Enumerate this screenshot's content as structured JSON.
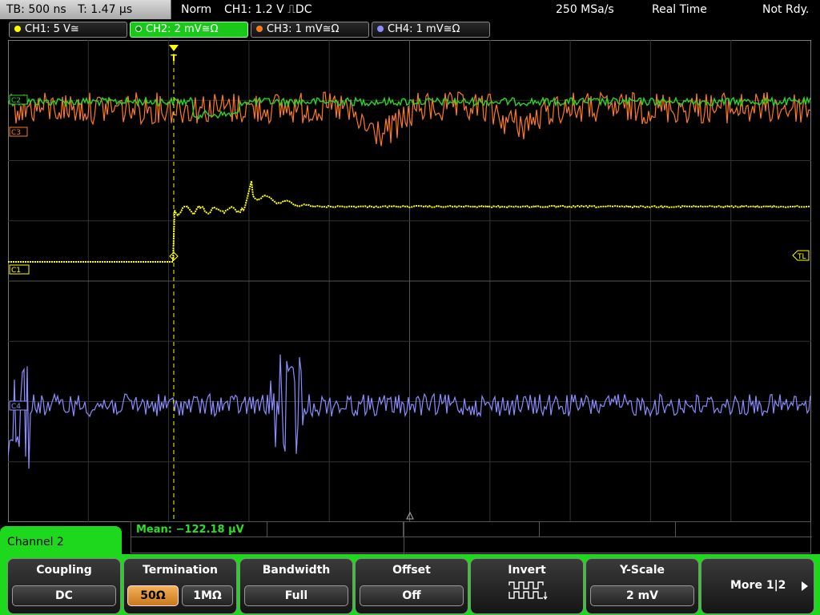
{
  "status": {
    "timebase": "TB: 500 ns",
    "trigger_time": "T: 1.47 µs",
    "mode": "Norm",
    "trigger": "CH1: 1.2 V ⎍DC",
    "sample_rate": "250 MSa/s",
    "acq_mode": "Real Time",
    "ready": "Not Rdy."
  },
  "channels": [
    {
      "label": "CH1: 5 V≅",
      "color": "#ffff00"
    },
    {
      "label": "CH2: 2 mV≅Ω",
      "color": "#27d627"
    },
    {
      "label": "CH3: 1 mV≅Ω",
      "color": "#ff7a1c"
    },
    {
      "label": "CH4: 1 mV≅Ω",
      "color": "#8c8cff"
    }
  ],
  "markers": {
    "c2": "C2",
    "c3": "C3",
    "c1": "C1",
    "c4": "C4",
    "trigger_level": "TL",
    "trigger_pos": "T"
  },
  "measurement": "Mean: −122.18 µV",
  "panel_title": "Channel 2",
  "softkeys": {
    "coupling": {
      "title": "Coupling",
      "value": "DC"
    },
    "termination": {
      "title": "Termination",
      "opt1": "50Ω",
      "opt2": "1MΩ"
    },
    "bandwidth": {
      "title": "Bandwidth",
      "value": "Full"
    },
    "offset": {
      "title": "Offset",
      "value": "Off"
    },
    "invert": {
      "title": "Invert",
      "icon": "invert-waveform-icon"
    },
    "yscale": {
      "title": "Y-Scale",
      "value": "2 mV"
    },
    "more": {
      "label": "More 1|2",
      "icon": "right-arrow-icon"
    }
  },
  "accent": "#1ed81e"
}
